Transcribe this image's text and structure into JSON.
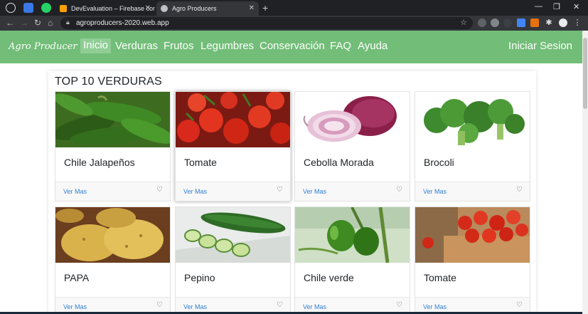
{
  "browser": {
    "tabs": [
      {
        "title": "DevEvaluation – Firebase console",
        "active": false
      },
      {
        "title": "Agro Producers",
        "active": true
      }
    ],
    "url": "agroproducers-2020.web.app"
  },
  "site": {
    "brand": "Agro Producer",
    "nav": [
      "Inicio",
      "Verduras",
      "Frutos",
      "Legumbres",
      "Conservación",
      "FAQ",
      "Ayuda"
    ],
    "active_nav": "Inicio",
    "login": "Iniciar Sesion"
  },
  "section": {
    "title": "TOP 10 VERDURAS",
    "more_label": "Ver Mas",
    "products": [
      {
        "name": "Chile Jalapeños",
        "icon": "jalapeno-photo"
      },
      {
        "name": "Tomate",
        "icon": "tomato-photo"
      },
      {
        "name": "Cebolla Morada",
        "icon": "red-onion-photo"
      },
      {
        "name": "Brocoli",
        "icon": "broccoli-photo"
      },
      {
        "name": "PAPA",
        "icon": "potato-photo"
      },
      {
        "name": "Pepino",
        "icon": "cucumber-photo"
      },
      {
        "name": "Chile verde",
        "icon": "green-chili-photo"
      },
      {
        "name": "Tomate",
        "icon": "tomato-crate-photo"
      }
    ]
  },
  "colors": {
    "navbar": "#72bd78",
    "active_nav": "#90cd95",
    "link": "#2f7fd1"
  }
}
